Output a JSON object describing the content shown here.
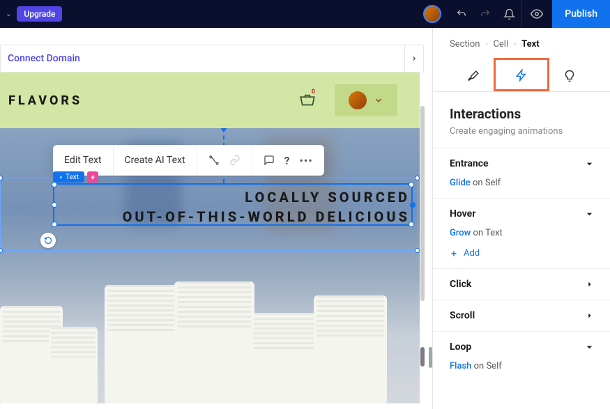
{
  "topbar": {
    "upgrade": "Upgrade",
    "publish": "Publish"
  },
  "connect": {
    "label": "Connect Domain"
  },
  "site": {
    "brand": "FLAVORS",
    "cart_count": "0"
  },
  "toolbar": {
    "edit_text": "Edit Text",
    "create_ai": "Create AI Text"
  },
  "selection": {
    "tag_label": "Text"
  },
  "headline": {
    "line1": "LOCALLY SOURCED",
    "line2": "OUT-OF-THIS-WORLD DELICIOUS"
  },
  "breadcrumb": {
    "a": "Section",
    "b": "Cell",
    "c": "Text"
  },
  "panel": {
    "title": "Interactions",
    "subtitle": "Create engaging animations"
  },
  "interactions": {
    "entrance": {
      "label": "Entrance",
      "anim": "Glide",
      "target": "on Self"
    },
    "hover": {
      "label": "Hover",
      "anim": "Grow",
      "target": "on Text",
      "add": "Add"
    },
    "click": {
      "label": "Click"
    },
    "scroll": {
      "label": "Scroll"
    },
    "loop": {
      "label": "Loop",
      "anim": "Flash",
      "target": "on Self"
    }
  }
}
